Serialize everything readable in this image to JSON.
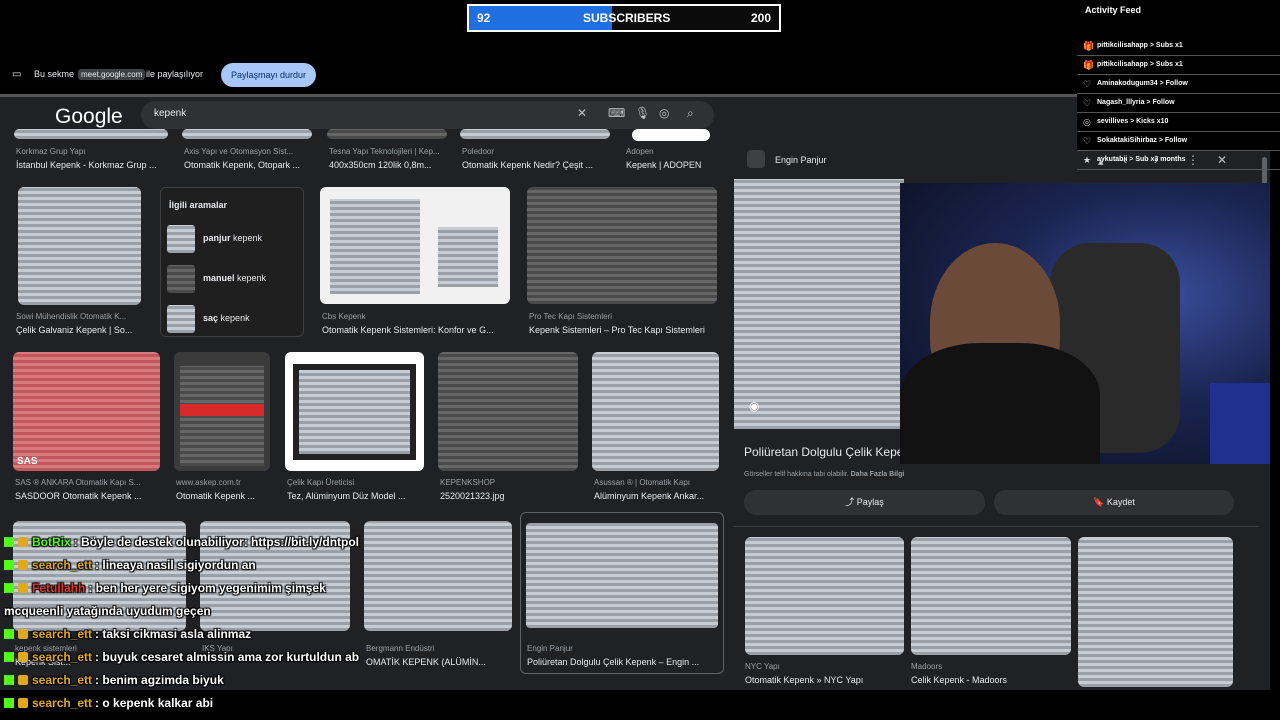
{
  "overlay": {
    "subscribers": {
      "current": "92",
      "label": "SUBSCRIBERS",
      "goal": "200",
      "progress": 0.46
    }
  },
  "sharebar": {
    "prefix": "Bu sekme",
    "domain": "meet.google.com",
    "suffix": "ile paylaşılıyor",
    "stop_label": "Paylaşmayı durdur"
  },
  "browser": {
    "logo": "Google",
    "search_query": "kepenk",
    "row1": [
      {
        "source": "Korkmaz Grup Yapı",
        "caption": "İstanbul Kepenk - Korkmaz Grup ..."
      },
      {
        "source": "Axis Yapı ve Otomasyon Sist...",
        "caption": "Otomatik Kepenk, Otopark ..."
      },
      {
        "source": "Tesna Yapı Teknolojileri | Kep...",
        "caption": "400x350cm 120lik 0,8m..."
      },
      {
        "source": "Poledoor",
        "caption": "Otomatik Kepenk Nedir? Çeşit ..."
      },
      {
        "source": "Adopen",
        "caption": "Kepenk | ADOPEN"
      }
    ],
    "row2": [
      {
        "source": "Sowi Mühendislik Otomatik K...",
        "caption": "Çelik Galvaniz Kepenk | So..."
      },
      {
        "source": "Cbs Kepenk",
        "caption": "Otomatik Kepenk Sistemleri: Konfor ve G..."
      },
      {
        "source": "Pro Tec Kapı Sistemleri",
        "caption": "Kepenk Sistemleri – Pro Tec Kapı Sistemleri"
      }
    ],
    "related": {
      "heading": "İlgili aramalar",
      "items": [
        {
          "bold": "panjur",
          "rest": "kepenk"
        },
        {
          "bold": "manuel",
          "rest": "kepenk"
        },
        {
          "bold": "saç",
          "rest": "kepenk"
        }
      ]
    },
    "row3": [
      {
        "source": "SAS ® ANKARA Otomatik Kapı S...",
        "caption": "SASDOOR Otomatik Kepenk ..."
      },
      {
        "source": "www.askep.com.tr",
        "caption": "Otomatik Kepenk ..."
      },
      {
        "source": "Çelik Kapı Üreticisi",
        "caption": "Tez, Alüminyum Düz Model ..."
      },
      {
        "source": "KEPENKSHOP",
        "caption": "2520021323.jpg"
      },
      {
        "source": "Asussan ® | Otomatik Kapı",
        "caption": "Alüminyum Kepenk Ankar..."
      }
    ],
    "row4": [
      {
        "source": "kepenk sistemleri",
        "caption": "Kepenk Sist..."
      },
      {
        "source": "IKS Yapı",
        "caption": "..."
      },
      {
        "source": "Bergmann Endüstri",
        "caption": "OMATİK KEPENK (ALÜMİN..."
      },
      {
        "source": "Engin Panjur",
        "caption": "Poliüretan Dolgulu Çelik Kepenk – Engin ..."
      }
    ],
    "sas_label": "SAS"
  },
  "panel": {
    "site": "Engin Panjur",
    "title": "Poliüretan Dolgulu Çelik Kepe",
    "note": "Görseller telif hakkına tabi olabilir.",
    "note_link": "Daha Fazla Bilgi",
    "share_label": "Paylaş",
    "save_label": "Kaydet",
    "related": [
      {
        "source": "NYC Yapı",
        "caption": "Otomatik Kepenk » NYC Yapı"
      },
      {
        "source": "Madoors",
        "caption": "Celik Kepenk - Madoors"
      },
      {
        "source": "",
        "caption": ""
      }
    ]
  },
  "feed": {
    "title": "Activity Feed",
    "items": [
      {
        "icon": "gift-icon",
        "text": "pittikcilisahapp > Subs x1"
      },
      {
        "icon": "gift-icon",
        "text": "pittikcilisahapp > Subs x1"
      },
      {
        "icon": "heart-icon",
        "text": "Aminakodugum34 > Follow"
      },
      {
        "icon": "heart-icon",
        "text": "Nagash_lllyria > Follow"
      },
      {
        "icon": "kick-icon",
        "text": "sevillives > Kicks x10"
      },
      {
        "icon": "heart-icon",
        "text": "SokaktakiSihirbaz > Follow"
      },
      {
        "icon": "star-icon",
        "text": "aykutabii > Sub x3 months"
      }
    ]
  },
  "chat": [
    {
      "user": "BotRix",
      "color": "#53fc18",
      "msg": ": Böyle de destek olunabiliyor: https://bit.ly/dntpol"
    },
    {
      "user": "search_ett",
      "color": "#e0a91c",
      "msg": ": lineaya nasil sigiyordun an"
    },
    {
      "user": "Fetullahh",
      "color": "#e0352b",
      "msg": ": ben her yere sigiyom yegenimim şimşek"
    },
    {
      "user": "",
      "color": "#fff",
      "msg": "mcqueenli yatağında uyudum geçen"
    },
    {
      "user": "search_ett",
      "color": "#e0a91c",
      "msg": ": taksi cikmasi asla alinmaz"
    },
    {
      "user": "search_ett",
      "color": "#e0a91c",
      "msg": ": buyuk cesaret almissin ama zor kurtuldun ab"
    },
    {
      "user": "search_ett",
      "color": "#e0a91c",
      "msg": ": benim agzimda biyuk"
    },
    {
      "user": "search_ett",
      "color": "#e0a91c",
      "msg": ": o kepenk kalkar abi"
    }
  ]
}
